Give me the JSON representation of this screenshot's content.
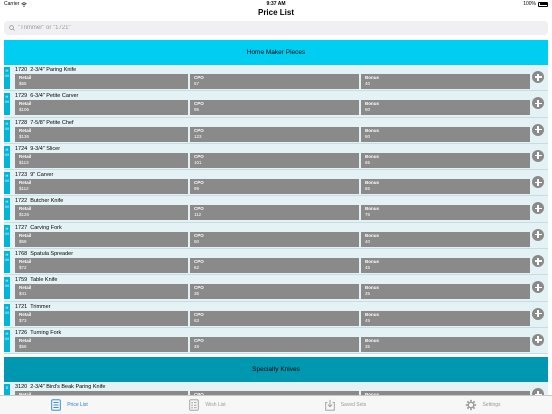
{
  "status": {
    "carrier": "Carrier",
    "time": "9:37 AM",
    "battery": "100%"
  },
  "nav": {
    "title": "Price List"
  },
  "search": {
    "placeholder": "\"Trimmer\" or \"1721\""
  },
  "labels": {
    "retail": "Retail",
    "cpo": "CPO",
    "bonus": "Bonus"
  },
  "sections": [
    {
      "title": "Home Maker Pieces",
      "items": [
        {
          "strip": [
            "H",
            "M"
          ],
          "num": "1720",
          "name": "2-3/4\" Paring Knife",
          "retail": "$65",
          "cpo": "57",
          "bonus": "40"
        },
        {
          "strip": [
            "H",
            "M"
          ],
          "num": "1729",
          "name": "6-3/4\" Petite Carver",
          "retail": "$106",
          "cpo": "95",
          "bonus": "60"
        },
        {
          "strip": [
            "H",
            "M"
          ],
          "num": "1728",
          "name": "7-5/8\" Petite Chef",
          "retail": "$136",
          "cpo": "123",
          "bonus": "80"
        },
        {
          "strip": [
            "H",
            "M"
          ],
          "num": "1724",
          "name": "9-3/4\" Slicer",
          "retail": "$113",
          "cpo": "101",
          "bonus": "65"
        },
        {
          "strip": [
            "H",
            "M"
          ],
          "num": "1723",
          "name": "9\" Carver",
          "retail": "$112",
          "cpo": "99",
          "bonus": "65"
        },
        {
          "strip": [
            "H",
            "M"
          ],
          "num": "1722",
          "name": "Butcher Knife",
          "retail": "$126",
          "cpo": "112",
          "bonus": "75"
        },
        {
          "strip": [
            "H",
            "M"
          ],
          "num": "1727",
          "name": "Carving Fork",
          "retail": "$58",
          "cpo": "50",
          "bonus": "40"
        },
        {
          "strip": [
            "H",
            "M"
          ],
          "num": "1768",
          "name": "Spatula Spreader",
          "retail": "$72",
          "cpo": "62",
          "bonus": "45"
        },
        {
          "strip": [
            "H",
            "M"
          ],
          "num": "1759",
          "name": "Table Knife",
          "retail": "$41",
          "cpo": "35",
          "bonus": "25"
        },
        {
          "strip": [
            "H",
            "M"
          ],
          "num": "1721",
          "name": "Trimmer",
          "retail": "$73",
          "cpo": "63",
          "bonus": "45"
        },
        {
          "strip": [
            "H",
            "M"
          ],
          "num": "1726",
          "name": "Turning Fork",
          "retail": "$56",
          "cpo": "48",
          "bonus": "35"
        }
      ]
    },
    {
      "title": "Specialty Knives",
      "items": [
        {
          "strip": [
            "S"
          ],
          "num": "3120",
          "name": "2-3/4\" Bird's Beak Paring Knife",
          "retail": "",
          "cpo": "",
          "bonus": ""
        }
      ]
    }
  ],
  "tabs": [
    {
      "label": "Price List",
      "icon": "price-list-icon",
      "active": true
    },
    {
      "label": "Wish List",
      "icon": "wish-list-icon",
      "active": false
    },
    {
      "label": "Saved Sets",
      "icon": "saved-sets-icon",
      "active": false
    },
    {
      "label": "Settings",
      "icon": "gear-icon",
      "active": false
    }
  ],
  "colors": {
    "section_home": "#00cdf2",
    "section_specialty": "#0098b0",
    "field": "#8a8a8a",
    "tab_active": "#1a7fd4"
  }
}
